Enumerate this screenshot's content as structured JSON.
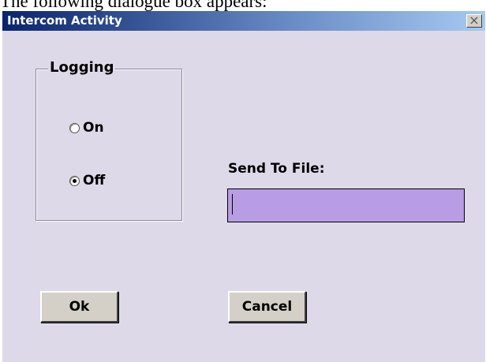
{
  "caption": "The following dialogue box appears:",
  "dialog": {
    "title": "Intercom Activity",
    "close_glyph": "×"
  },
  "logging": {
    "legend": "Logging",
    "options": [
      {
        "label": "On",
        "checked": false
      },
      {
        "label": "Off",
        "checked": true
      }
    ]
  },
  "send_to_file": {
    "label": "Send To File:",
    "value": "",
    "field_color": "#b89ce4"
  },
  "buttons": {
    "ok_label": "Ok",
    "cancel_label": "Cancel"
  },
  "colors": {
    "dialog_background": "#ddd9e8",
    "titlebar_start": "#0a246a",
    "titlebar_end": "#a6caf0"
  },
  "icons": {
    "close": "close-icon",
    "radio_on": "radio-unchecked-icon",
    "radio_off": "radio-checked-icon"
  }
}
